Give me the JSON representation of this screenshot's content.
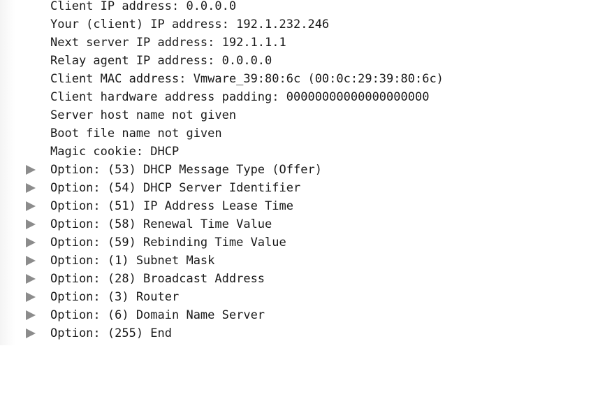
{
  "fields": [
    "Client IP address: 0.0.0.0",
    "Your (client) IP address: 192.1.232.246",
    "Next server IP address: 192.1.1.1",
    "Relay agent IP address: 0.0.0.0",
    "Client MAC address: Vmware_39:80:6c (00:0c:29:39:80:6c)",
    "Client hardware address padding: 00000000000000000000",
    "Server host name not given",
    "Boot file name not given",
    "Magic cookie: DHCP"
  ],
  "options": [
    "Option: (53) DHCP Message Type (Offer)",
    "Option: (54) DHCP Server Identifier",
    "Option: (51) IP Address Lease Time",
    "Option: (58) Renewal Time Value",
    "Option: (59) Rebinding Time Value",
    "Option: (1) Subnet Mask",
    "Option: (28) Broadcast Address",
    "Option: (3) Router",
    "Option: (6) Domain Name Server",
    "Option: (255) End"
  ],
  "icons": {
    "expander": "expand-triangle-icon"
  }
}
